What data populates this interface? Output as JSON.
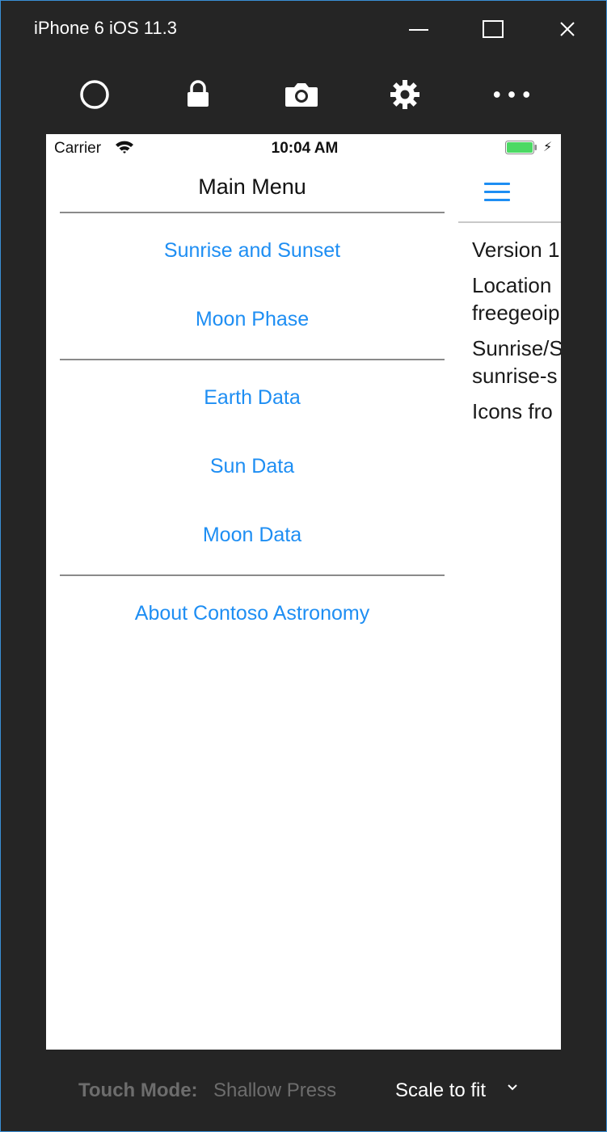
{
  "window": {
    "title": "iPhone 6 iOS 11.3",
    "accent_border": "#3a8fd6"
  },
  "toolbar": {
    "icons": [
      "home-circle-icon",
      "lock-icon",
      "camera-icon",
      "gear-icon",
      "more-icon"
    ]
  },
  "status_bar": {
    "carrier": "Carrier",
    "time": "10:04 AM",
    "battery_color": "#4cd964"
  },
  "menu": {
    "title": "Main Menu",
    "items": [
      {
        "label": "Sunrise and Sunset"
      },
      {
        "label": "Moon Phase"
      },
      {
        "label": "Earth Data"
      },
      {
        "label": "Sun Data"
      },
      {
        "label": "Moon Data"
      },
      {
        "label": "About Contoso Astronomy"
      }
    ],
    "link_color": "#1e8ef3"
  },
  "detail": {
    "lines": [
      "Version 1",
      "Location",
      "freegeoip",
      "Sunrise/S",
      "sunrise-s",
      "Icons fro"
    ]
  },
  "bottom_bar": {
    "touch_mode_label": "Touch Mode:",
    "touch_mode_value": "Shallow Press",
    "scale_label": "Scale to fit"
  }
}
